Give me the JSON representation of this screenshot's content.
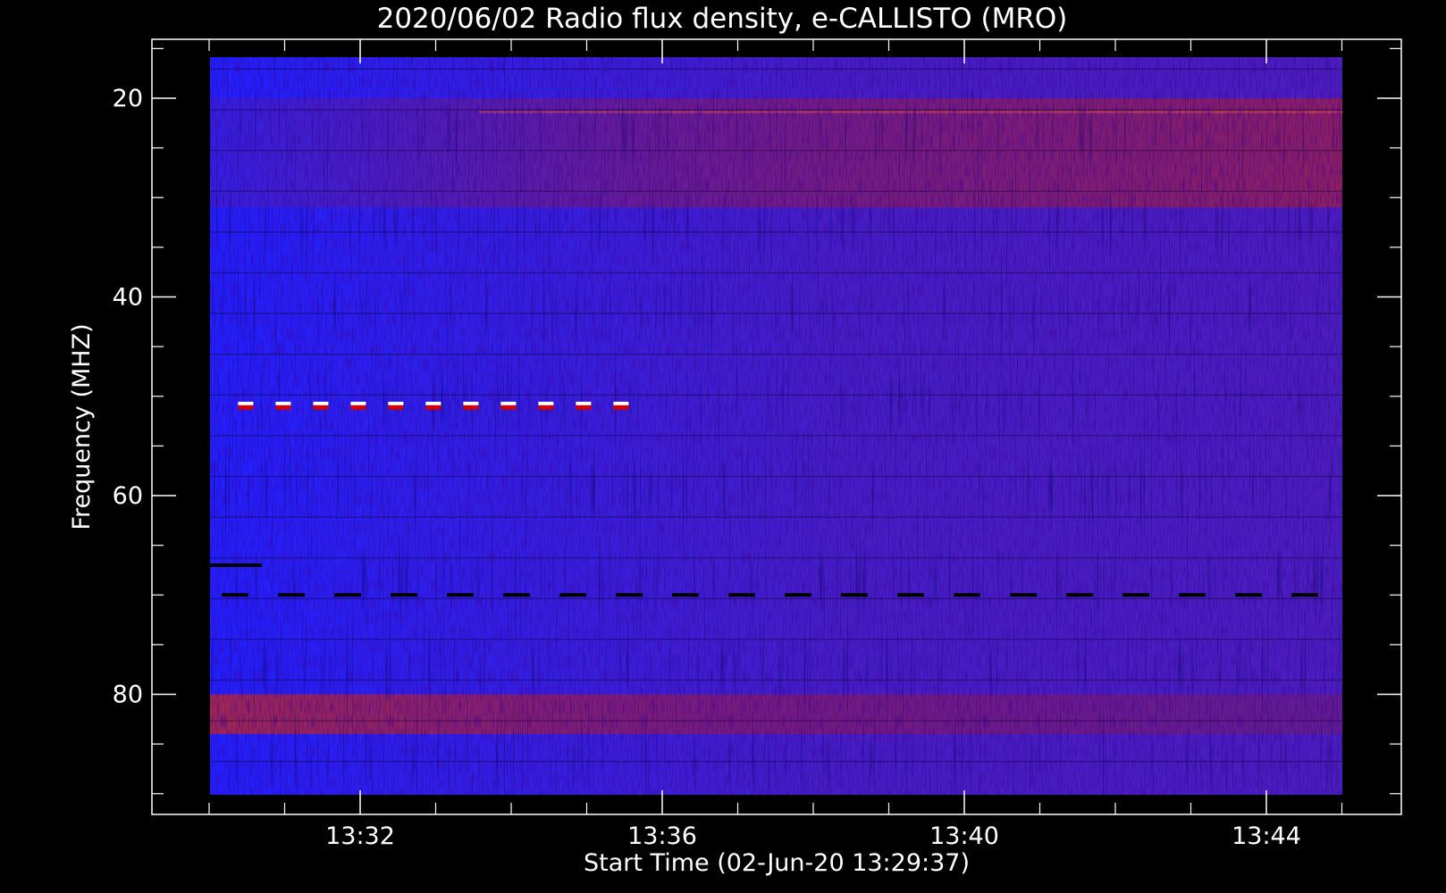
{
  "chart_data": {
    "type": "heatmap",
    "title": "2020/06/02  Radio flux density, e-CALLISTO (MRO)",
    "xlabel": "Start Time (02-Jun-20 13:29:37)",
    "ylabel": "Frequency (MHZ)",
    "x_ticks": [
      "13:32",
      "13:36",
      "13:40",
      "13:44"
    ],
    "y_ticks": [
      "20",
      "40",
      "60",
      "80"
    ],
    "ylim": [
      90,
      16
    ],
    "y_inverted": true,
    "colors": {
      "background": "#000000",
      "low": "#2020ff",
      "mid": "#a01840",
      "high": "#ff6030",
      "axis": "#ffffff"
    },
    "features": [
      {
        "kind": "dashed-marker",
        "freq_mhz": 51,
        "start": "13:30:23",
        "end": "13:35:24",
        "color": "#ffffff"
      },
      {
        "kind": "dashed-dark-line",
        "freq_mhz": 70,
        "start": "13:30:10",
        "end": "13:44:55"
      },
      {
        "kind": "dark-line",
        "freq_mhz": 67,
        "start": "13:29:40",
        "end": "13:30:42"
      },
      {
        "kind": "emission-band",
        "freq_mhz": [
          20,
          31
        ],
        "start": "13:29:37",
        "end": "13:44:58"
      },
      {
        "kind": "emission-band",
        "freq_mhz": [
          80,
          84
        ],
        "start": "13:29:37",
        "end": "13:44:58"
      }
    ]
  }
}
